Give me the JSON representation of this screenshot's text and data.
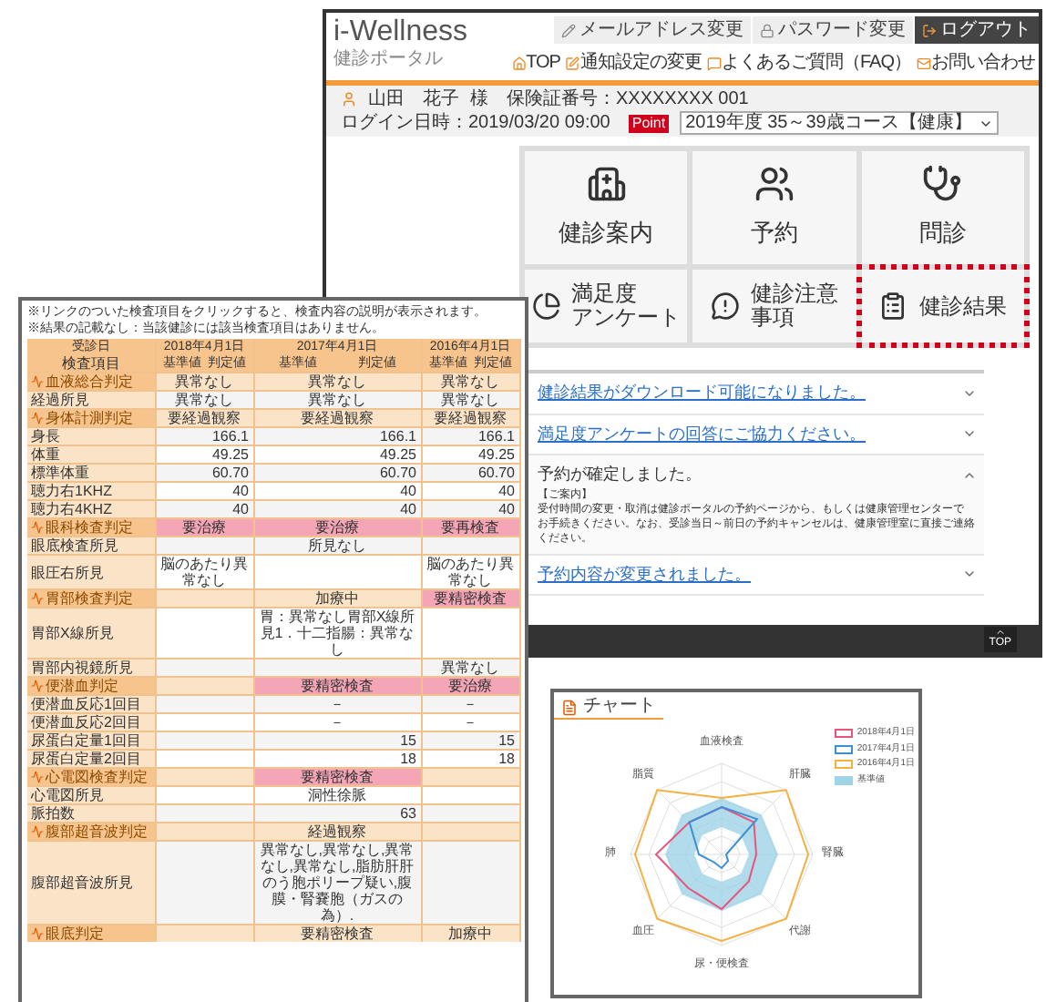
{
  "portal": {
    "logo": "i-Wellness",
    "subtitle": "健診ポータル",
    "account_buttons": [
      {
        "label": "メールアドレス変更",
        "kind": "mail"
      },
      {
        "label": "パスワード変更",
        "kind": "password"
      },
      {
        "label": "ログアウト",
        "kind": "logout"
      }
    ],
    "links": [
      {
        "label": "TOP",
        "kind": "home"
      },
      {
        "label": "通知設定の変更",
        "kind": "notify"
      },
      {
        "label": "よくあるご質問（FAQ）",
        "kind": "faq"
      },
      {
        "label": "お問い合わせ",
        "kind": "contact"
      }
    ],
    "user": {
      "name": "山田　花子",
      "honorific": "様",
      "insurance": "保険証番号：XXXXXXXX 001",
      "login": "ログイン日時：2019/03/20 09:00",
      "badge": "Point",
      "course": "2019年度 35～39歳コース【健康】"
    },
    "tiles": [
      {
        "lines": [
          "健診案内"
        ],
        "kind": "hospital",
        "highlighted": false
      },
      {
        "lines": [
          "予約"
        ],
        "kind": "reserve",
        "highlighted": false
      },
      {
        "lines": [
          "問診"
        ],
        "kind": "stethoscope",
        "highlighted": false
      },
      {
        "lines": [
          "満足度",
          "アンケート"
        ],
        "kind": "survey",
        "highlighted": false
      },
      {
        "lines": [
          "健診注意",
          "事項"
        ],
        "kind": "notice",
        "highlighted": false
      },
      {
        "lines": [
          "健診結果"
        ],
        "kind": "results",
        "highlighted": true
      }
    ],
    "news": [
      {
        "text": "健診結果がダウンロード可能になりました。",
        "expanded": false
      },
      {
        "text": "満足度アンケートの回答にご協力ください。",
        "expanded": false
      },
      {
        "text": "予約が確定しました。",
        "expanded": true,
        "body": [
          "【ご案内】",
          "受付時間の変更・取消は健診ポータルの予約ページから、もしくは健康管理センターで",
          "お手続きください。なお、受診当日～前日の予約キャンセルは、健康管理室に直接ご連絡ください。"
        ]
      },
      {
        "text": "予約内容が変更されました。",
        "expanded": false
      }
    ],
    "top_button": "TOP"
  },
  "results": {
    "notes": [
      "※リンクのついた検査項目をクリックすると、検査内容の説明が表示されます。",
      "※結果の記載なし：当該健診には該当検査項目はありません。"
    ],
    "columns": [
      "受診日",
      "2018年4月1日",
      "2017年4月1日",
      "2016年4月1日"
    ],
    "subcolumns": [
      "検査項目",
      "基準値",
      "判定値",
      "基準値",
      "判定値",
      "基準値",
      "判定値"
    ],
    "rows": [
      {
        "kind": "section",
        "cells": [
          {
            "text": "血液総合判定"
          },
          {
            "text": "異常なし",
            "flagged": false
          },
          {
            "text": "異常なし",
            "flagged": false
          },
          {
            "text": "異常なし",
            "flagged": false
          }
        ]
      },
      {
        "kind": "item",
        "cells": [
          {
            "text": "経過所見"
          },
          {
            "text": "異常なし",
            "flagged": false
          },
          {
            "text": "異常なし",
            "flagged": false
          },
          {
            "text": "異常なし",
            "flagged": false
          }
        ]
      },
      {
        "kind": "section",
        "cells": [
          {
            "text": "身体計測判定"
          },
          {
            "text": "要経過観察",
            "flagged": false
          },
          {
            "text": "要経過観察",
            "flagged": false
          },
          {
            "text": "要経過観察",
            "flagged": false
          }
        ]
      },
      {
        "kind": "measure",
        "cells": [
          {
            "text": "身長"
          },
          {
            "text": "166.1",
            "flagged": false
          },
          {
            "text": "166.1",
            "flagged": false
          },
          {
            "text": "166.1",
            "flagged": false
          }
        ]
      },
      {
        "kind": "measure",
        "cells": [
          {
            "text": "体重"
          },
          {
            "text": "49.25",
            "flagged": false
          },
          {
            "text": "49.25",
            "flagged": false
          },
          {
            "text": "49.25",
            "flagged": false
          }
        ]
      },
      {
        "kind": "measure",
        "cells": [
          {
            "text": "標準体重"
          },
          {
            "text": "60.70",
            "flagged": false
          },
          {
            "text": "60.70",
            "flagged": false
          },
          {
            "text": "60.70",
            "flagged": false
          }
        ]
      },
      {
        "kind": "measure",
        "cells": [
          {
            "text": "聴力右1KHZ"
          },
          {
            "text": "40",
            "flagged": false
          },
          {
            "text": "40",
            "flagged": false
          },
          {
            "text": "40",
            "flagged": false
          }
        ]
      },
      {
        "kind": "measure",
        "cells": [
          {
            "text": "聴力右4KHZ"
          },
          {
            "text": "40",
            "flagged": false
          },
          {
            "text": "40",
            "flagged": false
          },
          {
            "text": "40",
            "flagged": false
          }
        ]
      },
      {
        "kind": "section",
        "cells": [
          {
            "text": "眼科検査判定"
          },
          {
            "text": "要治療",
            "flagged": true
          },
          {
            "text": "要治療",
            "flagged": true
          },
          {
            "text": "要再検査",
            "flagged": true
          }
        ]
      },
      {
        "kind": "item",
        "cells": [
          {
            "text": "眼底検査所見"
          },
          {
            "text": "",
            "flagged": false
          },
          {
            "text": "所見なし",
            "flagged": false
          },
          {
            "text": "",
            "flagged": false
          }
        ]
      },
      {
        "kind": "item",
        "cells": [
          {
            "text": "眼圧右所見"
          },
          {
            "text": "脳のあたり異常なし",
            "flagged": false
          },
          {
            "text": "",
            "flagged": false
          },
          {
            "text": "脳のあたり異常なし",
            "flagged": false
          }
        ]
      },
      {
        "kind": "section",
        "cells": [
          {
            "text": "胃部検査判定"
          },
          {
            "text": "",
            "flagged": false
          },
          {
            "text": "加療中",
            "flagged": false
          },
          {
            "text": "要精密検査",
            "flagged": true
          }
        ]
      },
      {
        "kind": "item",
        "cells": [
          {
            "text": "胃部X線所見"
          },
          {
            "text": "",
            "flagged": false
          },
          {
            "text": "胃：異常なし胃部X線所見1．十二指腸：異常なし",
            "flagged": false
          },
          {
            "text": "",
            "flagged": false
          }
        ]
      },
      {
        "kind": "item",
        "cells": [
          {
            "text": "胃部内視鏡所見"
          },
          {
            "text": "",
            "flagged": false
          },
          {
            "text": "",
            "flagged": false
          },
          {
            "text": "異常なし",
            "flagged": false
          }
        ]
      },
      {
        "kind": "section",
        "cells": [
          {
            "text": "便潜血判定"
          },
          {
            "text": "",
            "flagged": false
          },
          {
            "text": "要精密検査",
            "flagged": true
          },
          {
            "text": "要治療",
            "flagged": true
          }
        ]
      },
      {
        "kind": "item",
        "cells": [
          {
            "text": "便潜血反応1回目"
          },
          {
            "text": "",
            "flagged": false
          },
          {
            "text": "－",
            "flagged": false
          },
          {
            "text": "－",
            "flagged": false
          }
        ]
      },
      {
        "kind": "item",
        "cells": [
          {
            "text": "便潜血反応2回目"
          },
          {
            "text": "",
            "flagged": false
          },
          {
            "text": "－",
            "flagged": false
          },
          {
            "text": "－",
            "flagged": false
          }
        ]
      },
      {
        "kind": "measure",
        "cells": [
          {
            "text": "尿蛋白定量1回目"
          },
          {
            "text": "",
            "flagged": false
          },
          {
            "text": "15",
            "flagged": false
          },
          {
            "text": "15",
            "flagged": false
          }
        ]
      },
      {
        "kind": "measure",
        "cells": [
          {
            "text": "尿蛋白定量2回目"
          },
          {
            "text": "",
            "flagged": false
          },
          {
            "text": "18",
            "flagged": false
          },
          {
            "text": "18",
            "flagged": false
          }
        ]
      },
      {
        "kind": "section",
        "cells": [
          {
            "text": "心電図検査判定"
          },
          {
            "text": "",
            "flagged": false
          },
          {
            "text": "要精密検査",
            "flagged": true
          },
          {
            "text": "",
            "flagged": false
          }
        ]
      },
      {
        "kind": "item",
        "cells": [
          {
            "text": "心電図所見"
          },
          {
            "text": "",
            "flagged": false
          },
          {
            "text": "洞性徐脈",
            "flagged": false
          },
          {
            "text": "",
            "flagged": false
          }
        ]
      },
      {
        "kind": "measure",
        "cells": [
          {
            "text": "脈拍数"
          },
          {
            "text": "",
            "flagged": false
          },
          {
            "text": "63",
            "flagged": false
          },
          {
            "text": "",
            "flagged": false
          }
        ]
      },
      {
        "kind": "section",
        "cells": [
          {
            "text": "腹部超音波判定"
          },
          {
            "text": "",
            "flagged": false
          },
          {
            "text": "経過観察",
            "flagged": false
          },
          {
            "text": "",
            "flagged": false
          }
        ]
      },
      {
        "kind": "item",
        "cells": [
          {
            "text": "腹部超音波所見"
          },
          {
            "text": "",
            "flagged": false
          },
          {
            "text": "異常なし,異常なし,異常なし,異常なし,脂肪肝肝のう胞ポリープ疑い,腹膜・腎嚢胞（ガスの為）.",
            "flagged": false
          },
          {
            "text": "",
            "flagged": false
          }
        ]
      },
      {
        "kind": "section",
        "cells": [
          {
            "text": "眼底判定"
          },
          {
            "text": "",
            "flagged": false
          },
          {
            "text": "要精密検査",
            "flagged": false
          },
          {
            "text": "加療中",
            "flagged": false
          }
        ]
      }
    ]
  },
  "chart": {
    "title": "チャート",
    "axes": [
      "血液検査",
      "肝臓",
      "腎臓",
      "代謝",
      "尿・便検査",
      "血圧",
      "肺",
      "脂質"
    ],
    "legend": [
      {
        "label": "2018年4月1日",
        "color": "#e8557a"
      },
      {
        "label": "2017年4月1日",
        "color": "#3a8fd8"
      },
      {
        "label": "2016年4月1日",
        "color": "#f5b040"
      },
      {
        "label": "基準値",
        "color": "#9fd3e6"
      }
    ]
  }
}
